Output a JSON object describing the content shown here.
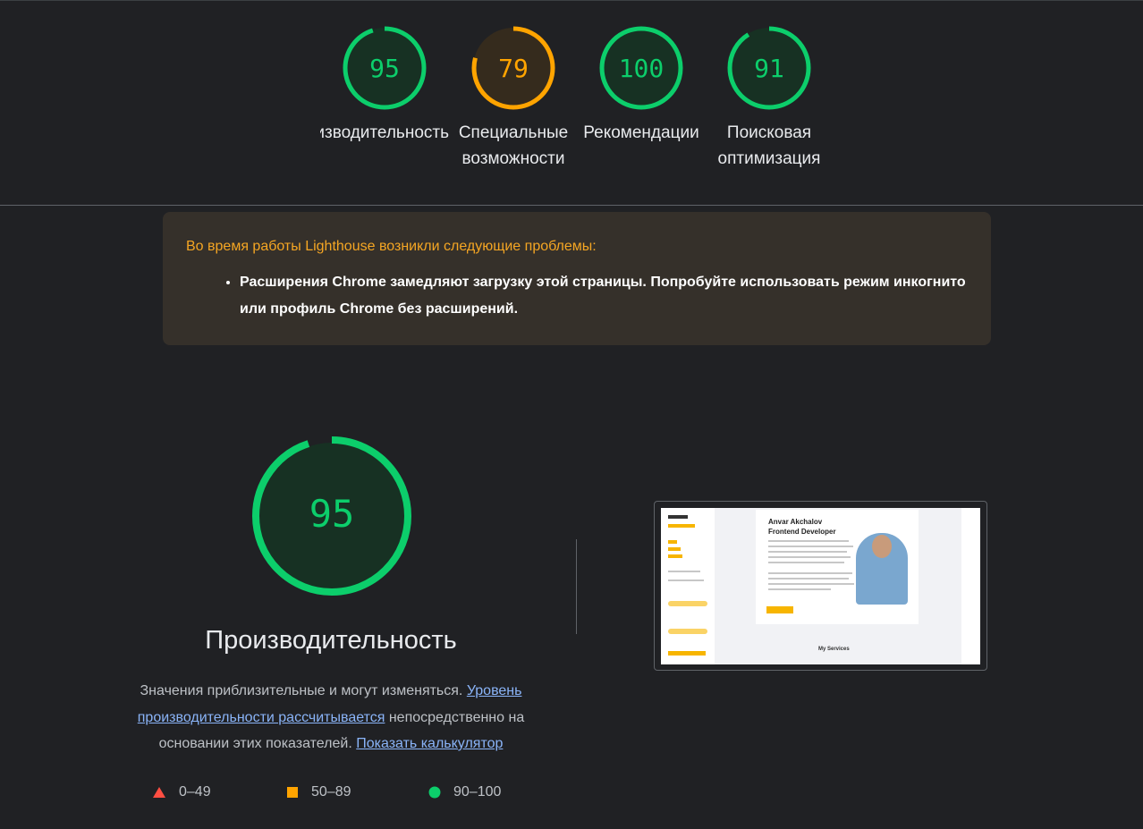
{
  "categories": [
    {
      "id": "performance",
      "score": 95,
      "label": "Производительность",
      "color": "#0cce6b"
    },
    {
      "id": "accessibility",
      "score": 79,
      "label": "Специальные возможности",
      "color": "#ffa400"
    },
    {
      "id": "best-practices",
      "score": 100,
      "label": "Рекомендации",
      "color": "#0cce6b"
    },
    {
      "id": "seo",
      "score": 91,
      "label": "Поисковая оптимизация",
      "color": "#0cce6b"
    }
  ],
  "warning": {
    "title": "Во время работы Lighthouse возникли следующие проблемы:",
    "items": [
      "Расширения Chrome замедляют загрузку этой страницы. Попробуйте использовать режим инкогнито или профиль Chrome без расширений."
    ]
  },
  "performance": {
    "score": 95,
    "title": "Производительность",
    "desc_part1": "Значения приблизительные и могут изменяться.",
    "link1": "Уровень производительности рассчитывается",
    "desc_part2": "непосредственно на основании этих показателей.",
    "link2": "Показать калькулятор"
  },
  "legend": [
    {
      "range": "0–49",
      "shape": "triangle",
      "color": "#ff4e42"
    },
    {
      "range": "50–89",
      "shape": "square",
      "color": "#ffa400"
    },
    {
      "range": "90–100",
      "shape": "circle",
      "color": "#0cce6b"
    }
  ],
  "screenshot": {
    "name": "Anvar Akchalov",
    "role": "Frontend Developer",
    "section": "My Services"
  },
  "colors": {
    "pass": "#0cce6b",
    "average": "#ffa400",
    "fail": "#ff4e42",
    "warning_text": "#f5a623",
    "link": "#8ab4f8"
  }
}
